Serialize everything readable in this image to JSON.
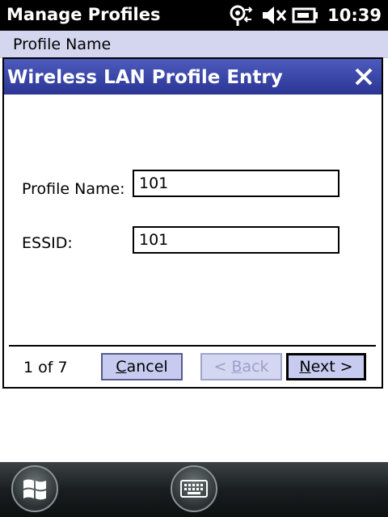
{
  "statusbar": {
    "app_title": "Manage Profiles",
    "time": "10:39",
    "icons": [
      "connectivity-icon",
      "speaker-muted-icon",
      "battery-icon"
    ]
  },
  "list": {
    "header_label": "Profile Name"
  },
  "dialog": {
    "title": "Wireless LAN Profile Entry",
    "close_icon": "close-icon",
    "fields": {
      "profile_name": {
        "label": "Profile Name:",
        "value": "101"
      },
      "essid": {
        "label": "ESSID:",
        "value": "101"
      }
    },
    "page_counter": "1 of 7",
    "buttons": {
      "cancel": {
        "mnemonic": "C",
        "rest": "ancel"
      },
      "back": {
        "prefix": "< ",
        "mnemonic": "B",
        "rest": "ack"
      },
      "next": {
        "mnemonic": "N",
        "rest": "ext >"
      }
    }
  },
  "taskbar": {
    "start_icon": "windows-start-icon",
    "keyboard_icon": "keyboard-icon"
  },
  "colors": {
    "titlebar": "#2a3594",
    "list_header": "#d4d6f0",
    "button_face": "#c7cbf0"
  }
}
